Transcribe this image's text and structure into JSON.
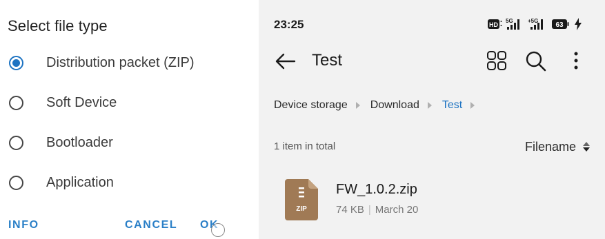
{
  "dialog": {
    "title": "Select file type",
    "options": [
      {
        "label": "Distribution packet (ZIP)",
        "selected": true
      },
      {
        "label": "Soft Device",
        "selected": false
      },
      {
        "label": "Bootloader",
        "selected": false
      },
      {
        "label": "Application",
        "selected": false
      }
    ],
    "actions": {
      "info": "INFO",
      "cancel": "CANCEL",
      "ok": "OK"
    }
  },
  "status_bar": {
    "time": "23:25",
    "hd_badge": "HD",
    "network_1": "5G",
    "network_2": "+5G",
    "battery": "63"
  },
  "file_manager": {
    "title": "Test",
    "breadcrumb": [
      "Device storage",
      "Download",
      "Test"
    ],
    "item_count": "1 item in total",
    "sort_label": "Filename",
    "files": [
      {
        "name": "FW_1.0.2.zip",
        "size": "74 KB",
        "date": "March 20",
        "type_label": "ZIP"
      }
    ]
  },
  "colors": {
    "accent_blue": "#1d73c2",
    "action_blue": "#2a7fc7",
    "file_icon_brown": "#a07a55",
    "right_panel_bg": "#f2f2f2"
  },
  "icons": {
    "back": "arrow-left-icon",
    "grid": "grid-view-icon",
    "search": "search-icon",
    "more": "more-vert-icon",
    "zip": "zip-file-icon"
  }
}
